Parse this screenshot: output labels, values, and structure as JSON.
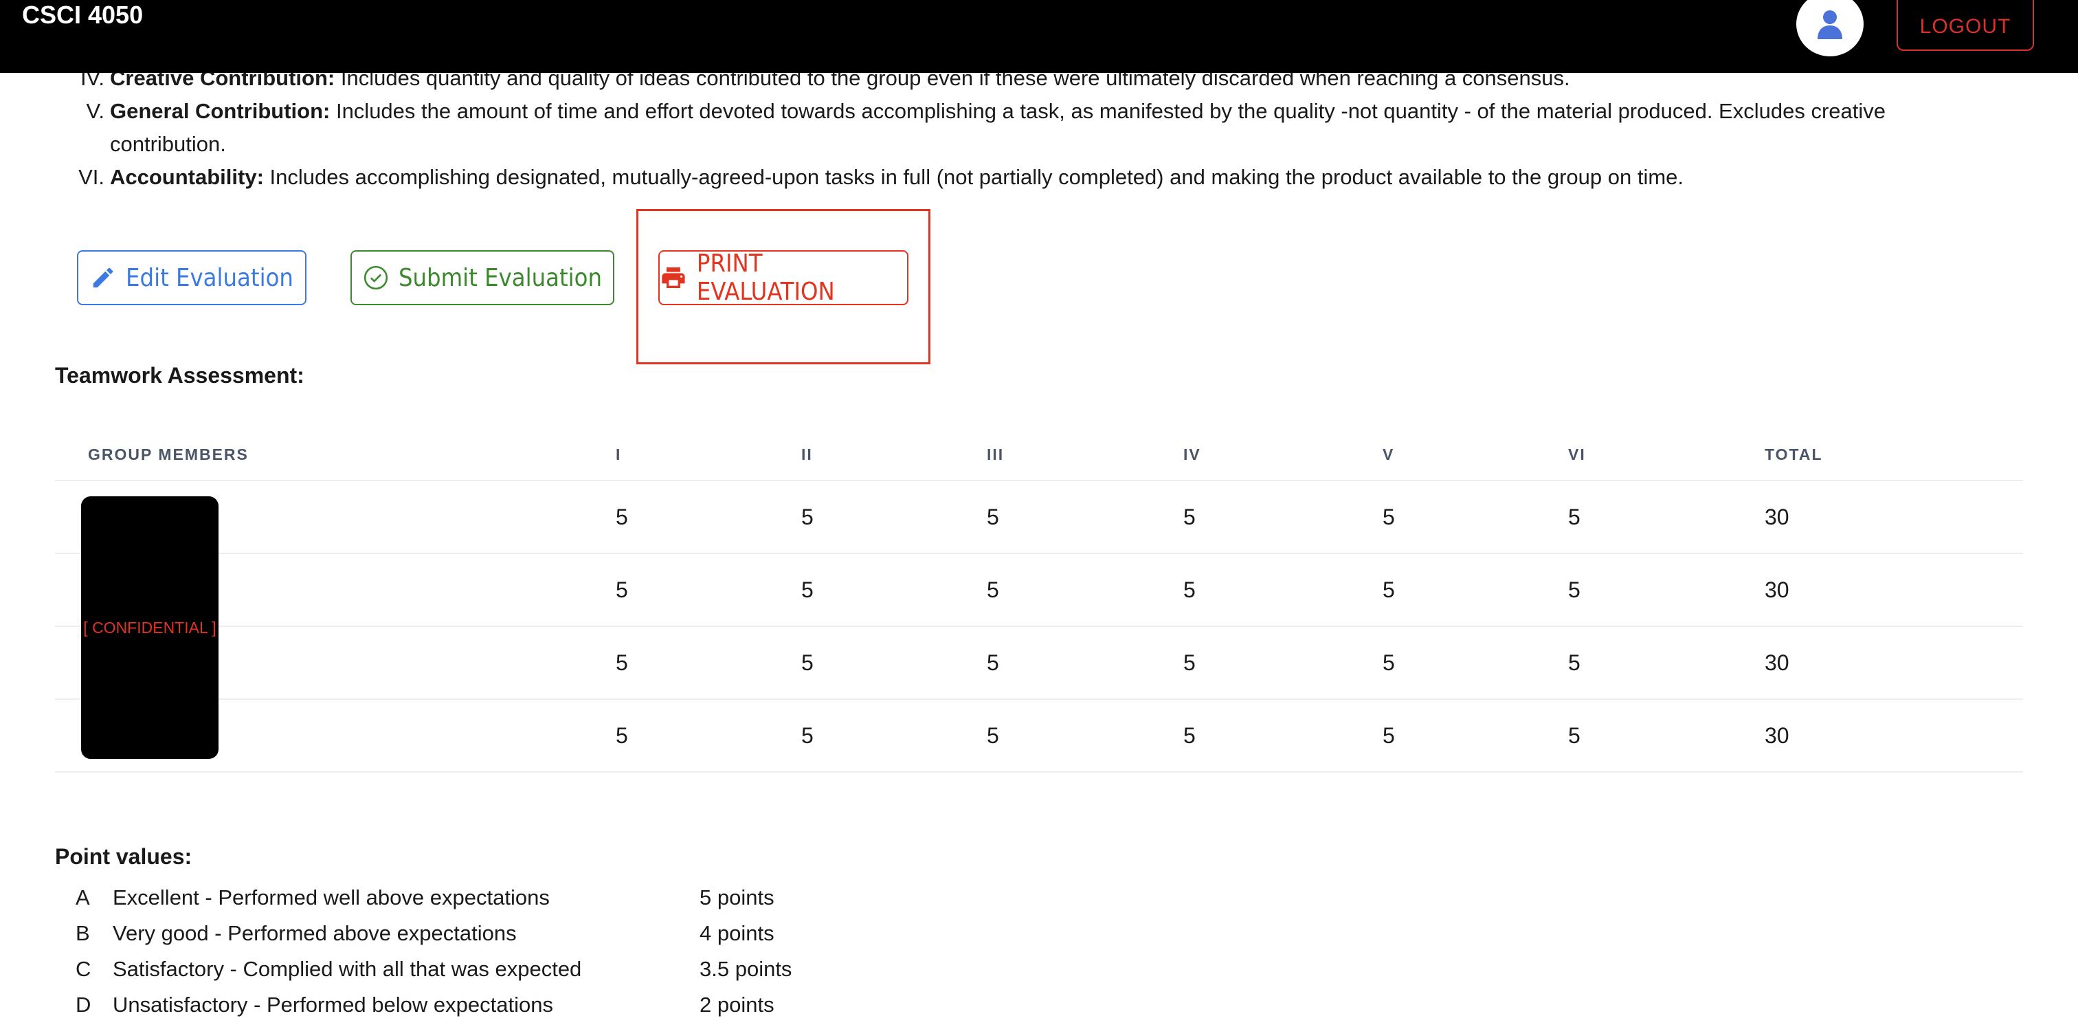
{
  "app": {
    "title": "CSCI 4050",
    "logout_label": "LOGOUT"
  },
  "colors": {
    "accent_red": "#e2341f",
    "edit_blue": "#3b7ae0",
    "submit_green": "#3a8a2c"
  },
  "criteria": [
    {
      "num": "IV.",
      "name": "Creative Contribution:",
      "text": "Includes quantity and quality of ideas contributed to the group even if these were ultimately discarded when reaching a consensus."
    },
    {
      "num": "V.",
      "name": "General Contribution:",
      "text": "Includes the amount of time and effort devoted towards accomplishing a task, as manifested by the quality -not quantity - of the material produced. Excludes creative contribution."
    },
    {
      "num": "VI.",
      "name": "Accountability:",
      "text": "Includes accomplishing designated, mutually-agreed-upon tasks in full (not partially completed) and making the product available to the group on time."
    }
  ],
  "buttons": {
    "edit": "Edit Evaluation",
    "submit": "Submit Evaluation",
    "print": "PRINT EVALUATION"
  },
  "teamwork": {
    "title": "Teamwork Assessment:",
    "headers": [
      "GROUP MEMBERS",
      "I",
      "II",
      "III",
      "IV",
      "V",
      "VI",
      "TOTAL"
    ],
    "redacted_label": "[ CONFIDENTIAL ]",
    "rows": [
      [
        "5",
        "5",
        "5",
        "5",
        "5",
        "5",
        "30"
      ],
      [
        "5",
        "5",
        "5",
        "5",
        "5",
        "5",
        "30"
      ],
      [
        "5",
        "5",
        "5",
        "5",
        "5",
        "5",
        "30"
      ],
      [
        "5",
        "5",
        "5",
        "5",
        "5",
        "5",
        "30"
      ]
    ]
  },
  "points": {
    "title": "Point values:",
    "items": [
      {
        "letter": "A",
        "desc": "Excellent - Performed well above expectations",
        "value": "5 points"
      },
      {
        "letter": "B",
        "desc": "Very good - Performed above expectations",
        "value": "4 points"
      },
      {
        "letter": "C",
        "desc": "Satisfactory - Complied with all that was expected",
        "value": "3.5 points"
      },
      {
        "letter": "D",
        "desc": "Unsatisfactory - Performed below expectations",
        "value": "2 points"
      }
    ]
  },
  "icons": {
    "avatar": "user-icon",
    "edit": "pencil-icon",
    "submit": "check-circle-icon",
    "print": "printer-icon"
  }
}
